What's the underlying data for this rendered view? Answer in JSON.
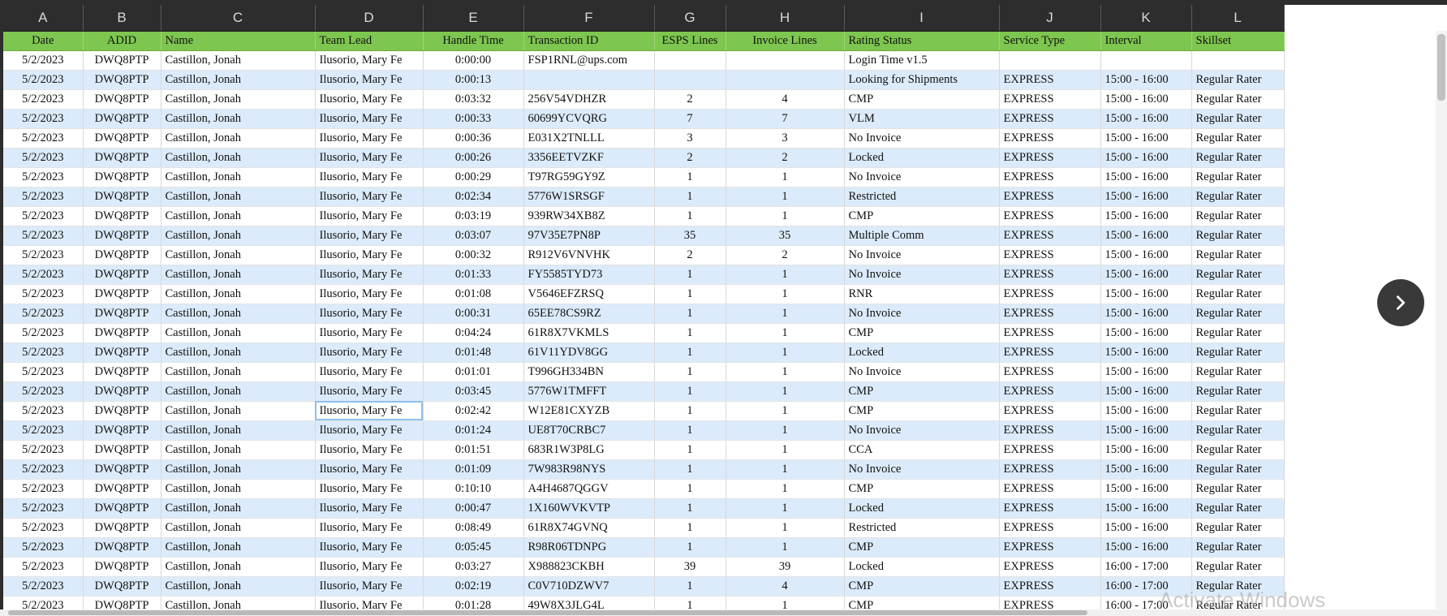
{
  "column_letters": [
    "A",
    "B",
    "C",
    "D",
    "E",
    "F",
    "G",
    "H",
    "I",
    "J",
    "K",
    "L"
  ],
  "headers": [
    "Date",
    "ADID",
    "Name",
    "Team Lead",
    "Handle Time",
    "Transaction ID",
    "ESPS Lines",
    "Invoice Lines",
    "Rating Status",
    "Service Type",
    "Interval",
    "Skillset"
  ],
  "rows": [
    [
      "5/2/2023",
      "DWQ8PTP",
      "Castillon, Jonah",
      "Ilusorio, Mary Fe",
      "0:00:00",
      "FSP1RNL@ups.com",
      "",
      "",
      "Login Time v1.5",
      "",
      "",
      ""
    ],
    [
      "5/2/2023",
      "DWQ8PTP",
      "Castillon, Jonah",
      "Ilusorio, Mary Fe",
      "0:00:13",
      "",
      "",
      "",
      "Looking for Shipments",
      "EXPRESS",
      "15:00 - 16:00",
      "Regular Rater"
    ],
    [
      "5/2/2023",
      "DWQ8PTP",
      "Castillon, Jonah",
      "Ilusorio, Mary Fe",
      "0:03:32",
      "256V54VDHZR",
      "2",
      "4",
      "CMP",
      "EXPRESS",
      "15:00 - 16:00",
      "Regular Rater"
    ],
    [
      "5/2/2023",
      "DWQ8PTP",
      "Castillon, Jonah",
      "Ilusorio, Mary Fe",
      "0:00:33",
      "60699YCVQRG",
      "7",
      "7",
      "VLM",
      "EXPRESS",
      "15:00 - 16:00",
      "Regular Rater"
    ],
    [
      "5/2/2023",
      "DWQ8PTP",
      "Castillon, Jonah",
      "Ilusorio, Mary Fe",
      "0:00:36",
      "E031X2TNLLL",
      "3",
      "3",
      "No Invoice",
      "EXPRESS",
      "15:00 - 16:00",
      "Regular Rater"
    ],
    [
      "5/2/2023",
      "DWQ8PTP",
      "Castillon, Jonah",
      "Ilusorio, Mary Fe",
      "0:00:26",
      "3356EETVZKF",
      "2",
      "2",
      "Locked",
      "EXPRESS",
      "15:00 - 16:00",
      "Regular Rater"
    ],
    [
      "5/2/2023",
      "DWQ8PTP",
      "Castillon, Jonah",
      "Ilusorio, Mary Fe",
      "0:00:29",
      "T97RG59GY9Z",
      "1",
      "1",
      "No Invoice",
      "EXPRESS",
      "15:00 - 16:00",
      "Regular Rater"
    ],
    [
      "5/2/2023",
      "DWQ8PTP",
      "Castillon, Jonah",
      "Ilusorio, Mary Fe",
      "0:02:34",
      "5776W1SRSGF",
      "1",
      "1",
      "Restricted",
      "EXPRESS",
      "15:00 - 16:00",
      "Regular Rater"
    ],
    [
      "5/2/2023",
      "DWQ8PTP",
      "Castillon, Jonah",
      "Ilusorio, Mary Fe",
      "0:03:19",
      "939RW34XB8Z",
      "1",
      "1",
      "CMP",
      "EXPRESS",
      "15:00 - 16:00",
      "Regular Rater"
    ],
    [
      "5/2/2023",
      "DWQ8PTP",
      "Castillon, Jonah",
      "Ilusorio, Mary Fe",
      "0:03:07",
      "97V35E7PN8P",
      "35",
      "35",
      "Multiple Comm",
      "EXPRESS",
      "15:00 - 16:00",
      "Regular Rater"
    ],
    [
      "5/2/2023",
      "DWQ8PTP",
      "Castillon, Jonah",
      "Ilusorio, Mary Fe",
      "0:00:32",
      "R912V6VNVHK",
      "2",
      "2",
      "No Invoice",
      "EXPRESS",
      "15:00 - 16:00",
      "Regular Rater"
    ],
    [
      "5/2/2023",
      "DWQ8PTP",
      "Castillon, Jonah",
      "Ilusorio, Mary Fe",
      "0:01:33",
      "FY5585TYD73",
      "1",
      "1",
      "No Invoice",
      "EXPRESS",
      "15:00 - 16:00",
      "Regular Rater"
    ],
    [
      "5/2/2023",
      "DWQ8PTP",
      "Castillon, Jonah",
      "Ilusorio, Mary Fe",
      "0:01:08",
      "V5646EFZRSQ",
      "1",
      "1",
      "RNR",
      "EXPRESS",
      "15:00 - 16:00",
      "Regular Rater"
    ],
    [
      "5/2/2023",
      "DWQ8PTP",
      "Castillon, Jonah",
      "Ilusorio, Mary Fe",
      "0:00:31",
      "65EE78CS9RZ",
      "1",
      "1",
      "No Invoice",
      "EXPRESS",
      "15:00 - 16:00",
      "Regular Rater"
    ],
    [
      "5/2/2023",
      "DWQ8PTP",
      "Castillon, Jonah",
      "Ilusorio, Mary Fe",
      "0:04:24",
      "61R8X7VKMLS",
      "1",
      "1",
      "CMP",
      "EXPRESS",
      "15:00 - 16:00",
      "Regular Rater"
    ],
    [
      "5/2/2023",
      "DWQ8PTP",
      "Castillon, Jonah",
      "Ilusorio, Mary Fe",
      "0:01:48",
      "61V11YDV8GG",
      "1",
      "1",
      "Locked",
      "EXPRESS",
      "15:00 - 16:00",
      "Regular Rater"
    ],
    [
      "5/2/2023",
      "DWQ8PTP",
      "Castillon, Jonah",
      "Ilusorio, Mary Fe",
      "0:01:01",
      "T996GH334BN",
      "1",
      "1",
      "No Invoice",
      "EXPRESS",
      "15:00 - 16:00",
      "Regular Rater"
    ],
    [
      "5/2/2023",
      "DWQ8PTP",
      "Castillon, Jonah",
      "Ilusorio, Mary Fe",
      "0:03:45",
      "5776W1TMFFT",
      "1",
      "1",
      "CMP",
      "EXPRESS",
      "15:00 - 16:00",
      "Regular Rater"
    ],
    [
      "5/2/2023",
      "DWQ8PTP",
      "Castillon, Jonah",
      "Ilusorio, Mary Fe",
      "0:02:42",
      "W12E81CXYZB",
      "1",
      "1",
      "CMP",
      "EXPRESS",
      "15:00 - 16:00",
      "Regular Rater"
    ],
    [
      "5/2/2023",
      "DWQ8PTP",
      "Castillon, Jonah",
      "Ilusorio, Mary Fe",
      "0:01:24",
      "UE8T70CRBC7",
      "1",
      "1",
      "No Invoice",
      "EXPRESS",
      "15:00 - 16:00",
      "Regular Rater"
    ],
    [
      "5/2/2023",
      "DWQ8PTP",
      "Castillon, Jonah",
      "Ilusorio, Mary Fe",
      "0:01:51",
      "683R1W3P8LG",
      "1",
      "1",
      "CCA",
      "EXPRESS",
      "15:00 - 16:00",
      "Regular Rater"
    ],
    [
      "5/2/2023",
      "DWQ8PTP",
      "Castillon, Jonah",
      "Ilusorio, Mary Fe",
      "0:01:09",
      "7W983R98NYS",
      "1",
      "1",
      "No Invoice",
      "EXPRESS",
      "15:00 - 16:00",
      "Regular Rater"
    ],
    [
      "5/2/2023",
      "DWQ8PTP",
      "Castillon, Jonah",
      "Ilusorio, Mary Fe",
      "0:10:10",
      "A4H4687QGGV",
      "1",
      "1",
      "CMP",
      "EXPRESS",
      "15:00 - 16:00",
      "Regular Rater"
    ],
    [
      "5/2/2023",
      "DWQ8PTP",
      "Castillon, Jonah",
      "Ilusorio, Mary Fe",
      "0:00:47",
      "1X160WVKVTP",
      "1",
      "1",
      "Locked",
      "EXPRESS",
      "15:00 - 16:00",
      "Regular Rater"
    ],
    [
      "5/2/2023",
      "DWQ8PTP",
      "Castillon, Jonah",
      "Ilusorio, Mary Fe",
      "0:08:49",
      "61R8X74GVNQ",
      "1",
      "1",
      "Restricted",
      "EXPRESS",
      "15:00 - 16:00",
      "Regular Rater"
    ],
    [
      "5/2/2023",
      "DWQ8PTP",
      "Castillon, Jonah",
      "Ilusorio, Mary Fe",
      "0:05:45",
      "R98R06TDNPG",
      "1",
      "1",
      "CMP",
      "EXPRESS",
      "15:00 - 16:00",
      "Regular Rater"
    ],
    [
      "5/2/2023",
      "DWQ8PTP",
      "Castillon, Jonah",
      "Ilusorio, Mary Fe",
      "0:03:27",
      "X988823CKBH",
      "39",
      "39",
      "Locked",
      "EXPRESS",
      "16:00 - 17:00",
      "Regular Rater"
    ],
    [
      "5/2/2023",
      "DWQ8PTP",
      "Castillon, Jonah",
      "Ilusorio, Mary Fe",
      "0:02:19",
      "C0V710DZWV7",
      "1",
      "4",
      "CMP",
      "EXPRESS",
      "16:00 - 17:00",
      "Regular Rater"
    ],
    [
      "5/2/2023",
      "DWQ8PTP",
      "Castillon, Jonah",
      "Ilusorio, Mary Fe",
      "0:01:28",
      "49W8X3JLG4L",
      "1",
      "1",
      "CMP",
      "EXPRESS",
      "16:00 - 17:00",
      "Regular Rater"
    ]
  ],
  "selected_cell": {
    "row": 18,
    "col": 3
  },
  "watermark": "Activate Windows",
  "icons": {
    "next_button": "chevron-right-icon"
  },
  "colors": {
    "header_green": "#7dc64f",
    "stripe_blue": "#dcebfb",
    "column_header_bg": "#2d2d2d"
  }
}
